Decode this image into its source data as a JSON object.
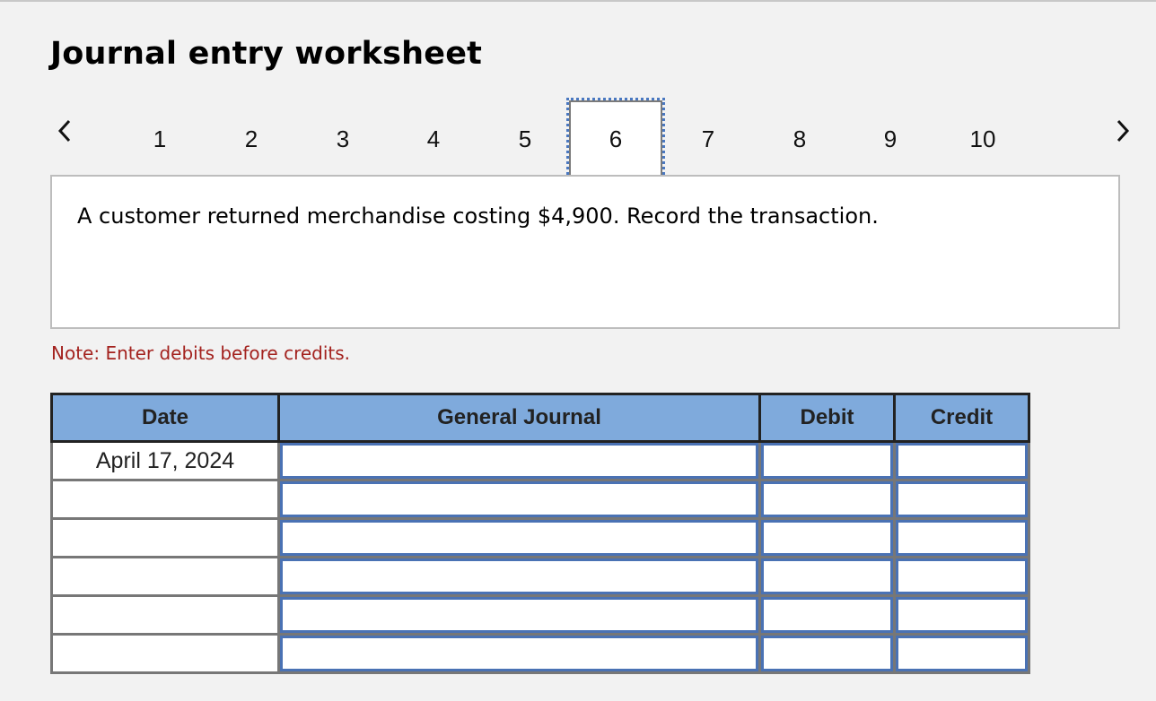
{
  "header": {
    "title": "Journal entry worksheet"
  },
  "pager": {
    "prev_icon": "chevron-left-icon",
    "next_icon": "chevron-right-icon",
    "pages": [
      "1",
      "2",
      "3",
      "4",
      "5",
      "6",
      "7",
      "8",
      "9",
      "10"
    ],
    "active_page": "6"
  },
  "prompt": {
    "text": "A customer returned merchandise costing $4,900. Record the transaction."
  },
  "note": {
    "text": "Note: Enter debits before credits."
  },
  "journal": {
    "columns": {
      "date": "Date",
      "general_journal": "General Journal",
      "debit": "Debit",
      "credit": "Credit"
    },
    "rows": [
      {
        "date": "April 17, 2024",
        "account": "",
        "debit": "",
        "credit": ""
      },
      {
        "date": "",
        "account": "",
        "debit": "",
        "credit": ""
      },
      {
        "date": "",
        "account": "",
        "debit": "",
        "credit": ""
      },
      {
        "date": "",
        "account": "",
        "debit": "",
        "credit": ""
      },
      {
        "date": "",
        "account": "",
        "debit": "",
        "credit": ""
      },
      {
        "date": "",
        "account": "",
        "debit": "",
        "credit": ""
      }
    ]
  },
  "colors": {
    "header_bg": "#7faadc",
    "input_border": "#4a72b4",
    "note_text": "#a3221e",
    "active_outline": "#4a78c0"
  }
}
